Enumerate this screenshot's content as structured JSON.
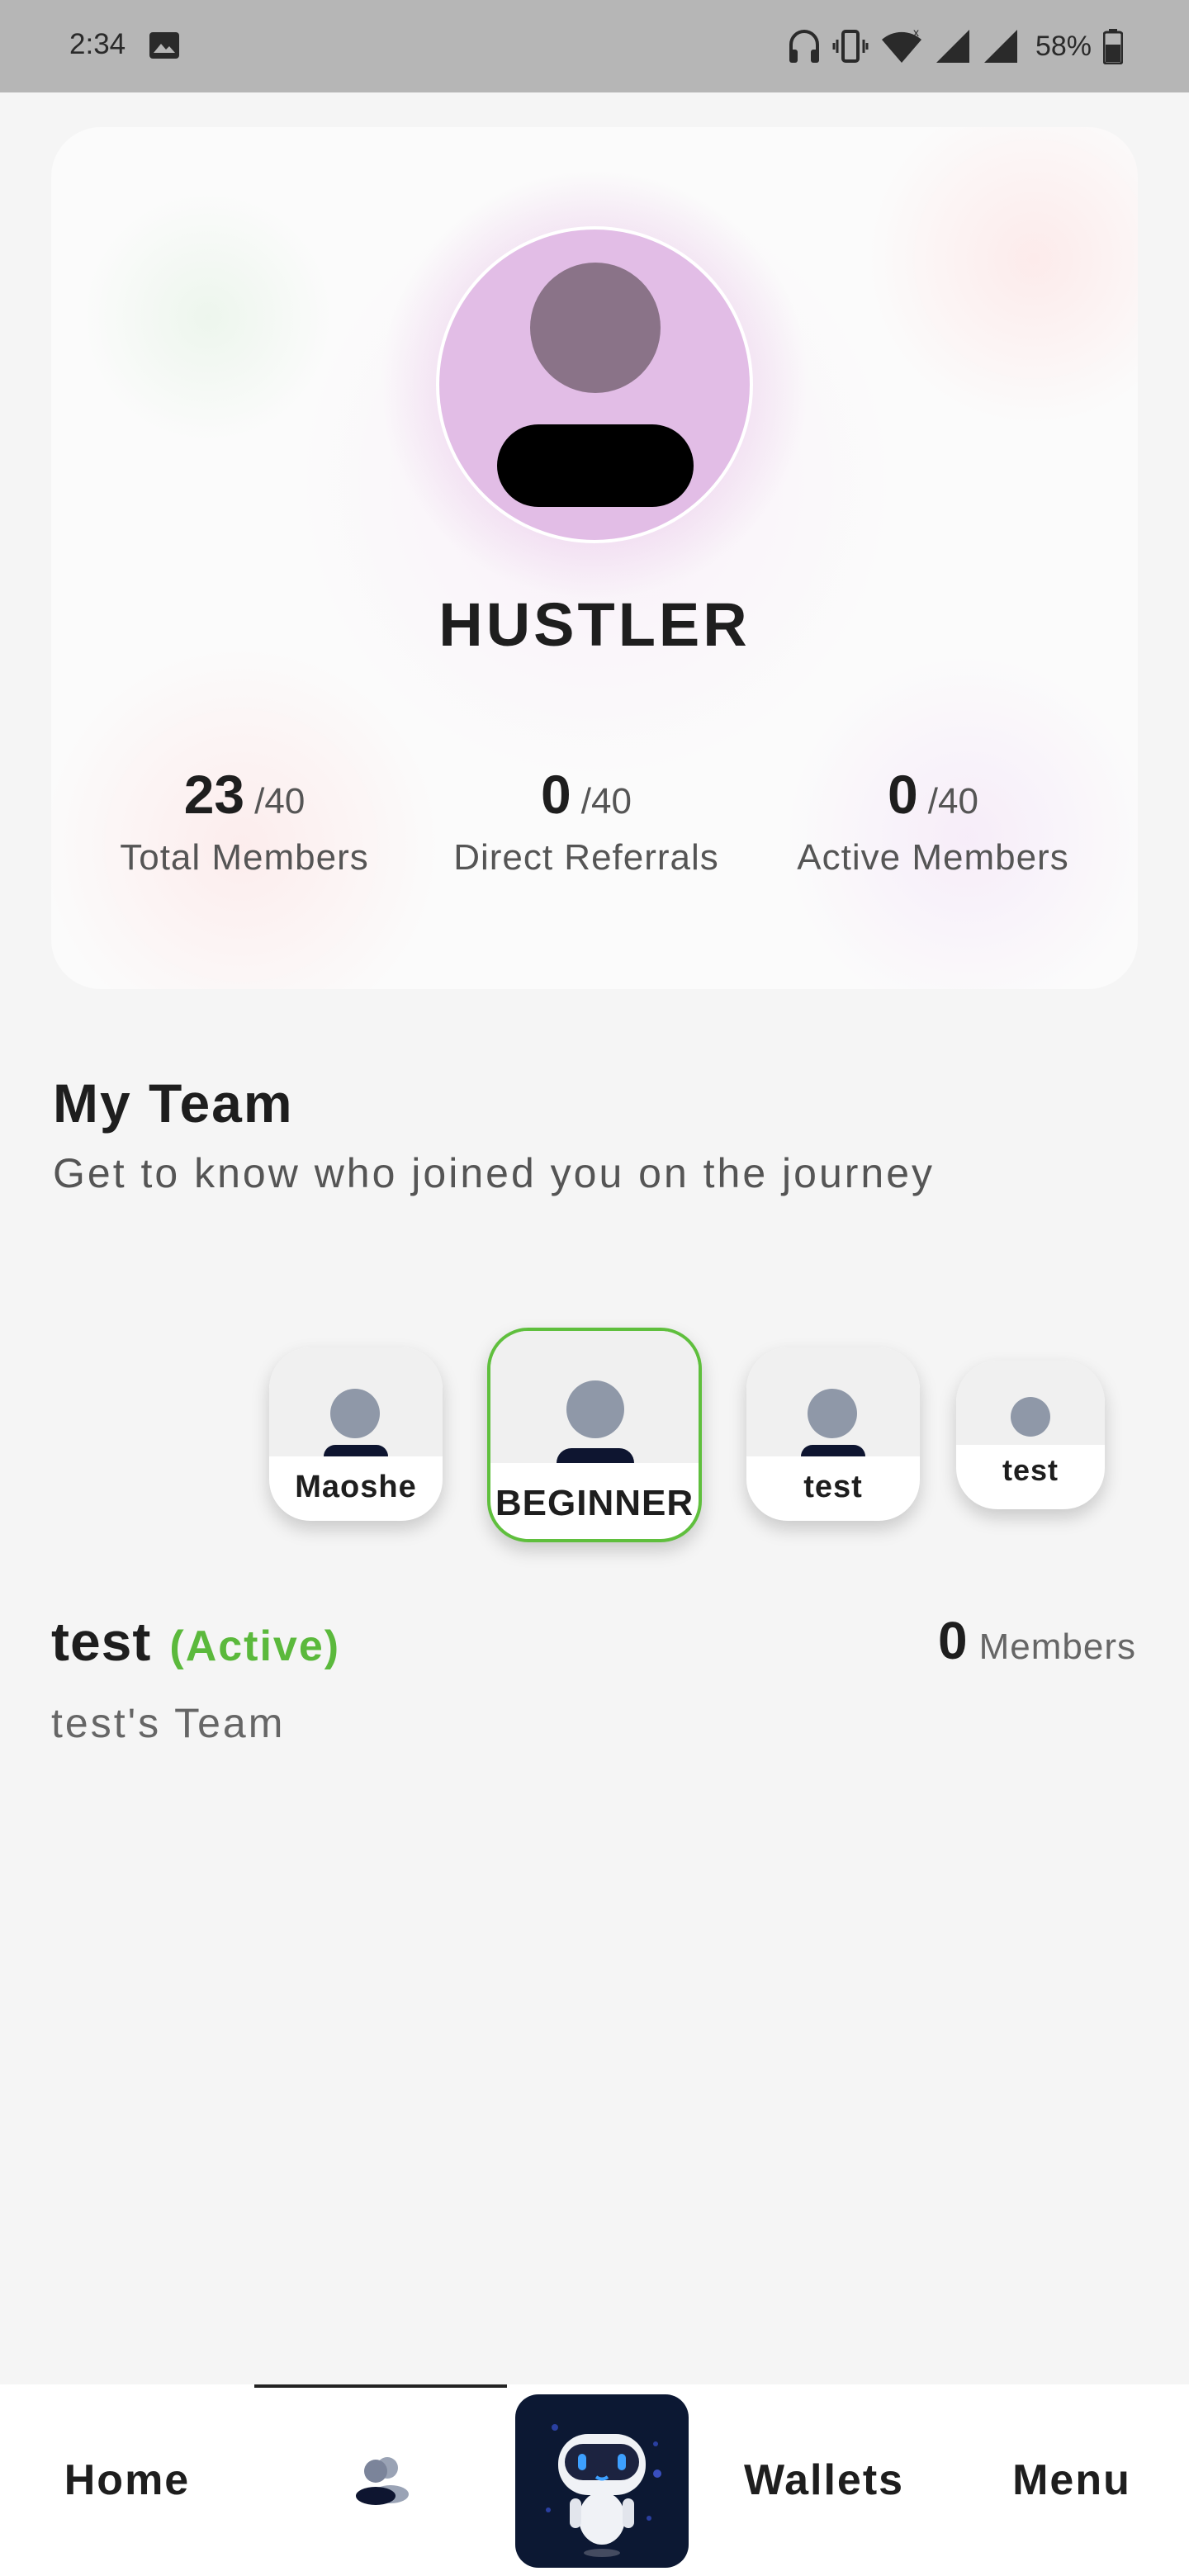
{
  "status_bar": {
    "time": "2:34",
    "battery": "58%",
    "icons": [
      "image-icon",
      "headphones-icon",
      "vibrate-icon",
      "wifi-icon",
      "signal-icon",
      "signal-icon",
      "battery-icon"
    ]
  },
  "profile": {
    "rank": "HUSTLER",
    "stats": [
      {
        "value": "23",
        "max": "/40",
        "label": "Total Members"
      },
      {
        "value": "0",
        "max": "/40",
        "label": "Direct Referrals"
      },
      {
        "value": "0",
        "max": "/40",
        "label": "Active Members"
      }
    ]
  },
  "team": {
    "title": "My Team",
    "subtitle": "Get to know who joined you on the journey",
    "members": [
      {
        "label": "Maoshe"
      },
      {
        "label": "BEGINNER"
      },
      {
        "label": "test"
      },
      {
        "label": "test"
      }
    ],
    "selected": {
      "name": "test",
      "status": "(Active)",
      "team_name": "test's Team",
      "member_count": "0",
      "member_word": "Members"
    }
  },
  "nav": {
    "home": "Home",
    "wallets": "Wallets",
    "menu": "Menu",
    "team_icon": "team-icon",
    "bot_icon": "robot-icon"
  },
  "colors": {
    "accent_green": "#5bb93c",
    "status_bar": "#b6b6b6",
    "avatar_bg": "#e2bde6",
    "bot_bg": "#0c1833"
  }
}
